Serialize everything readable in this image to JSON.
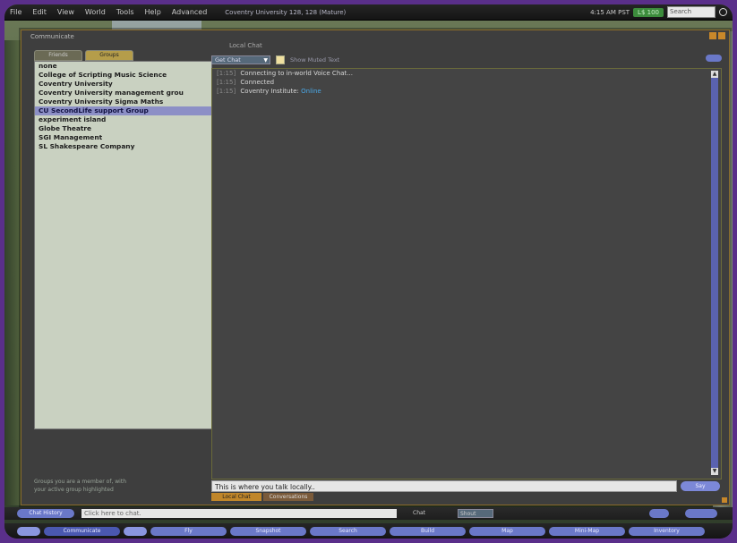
{
  "menu": {
    "items": [
      "File",
      "Edit",
      "View",
      "World",
      "Tools",
      "Help",
      "Advanced"
    ],
    "region": "Coventry University 128, 128 (Mature)",
    "time": "4:15 AM PST",
    "money": "L$ 100",
    "search_placeholder": "Search"
  },
  "chat_window": {
    "title": "Communicate",
    "subtitle": "Local Chat",
    "tabs": [
      "Friends",
      "Groups"
    ],
    "groups": [
      "none",
      "College of Scripting Music Science",
      "Coventry University",
      "Coventry University management grou",
      "Coventry University Sigma Maths",
      "CU SecondLife support Group",
      "experiment island",
      "Globe Theatre",
      "SGI Management",
      "SL Shakespeare Company"
    ],
    "selected_group_index": 5,
    "left_footer": [
      "Groups you are a member of, with",
      "your active group highlighted"
    ],
    "toolbar": {
      "dropdown": "Get Chat",
      "checkbox_label": "Show Muted Text"
    },
    "history": [
      {
        "time": "[1:15]",
        "text": "Connecting to in-world Voice Chat..."
      },
      {
        "time": "[1:15]",
        "text": "Connected"
      },
      {
        "time": "[1:15]",
        "text": "Coventry Institute:",
        "status": "Online"
      }
    ],
    "input_value": "This is where you talk locally..",
    "send_label": "Say",
    "bottom_tabs": [
      "Local Chat",
      "Conversations"
    ]
  },
  "chatbar": {
    "history_label": "Chat History",
    "input_placeholder": "Click here to chat.",
    "channel_label": "Chat",
    "shout_label": "Shout"
  },
  "bottom_buttons": [
    "Communicate",
    "Fly",
    "Snapshot",
    "Search",
    "Build",
    "Map",
    "Mini-Map",
    "Inventory"
  ]
}
